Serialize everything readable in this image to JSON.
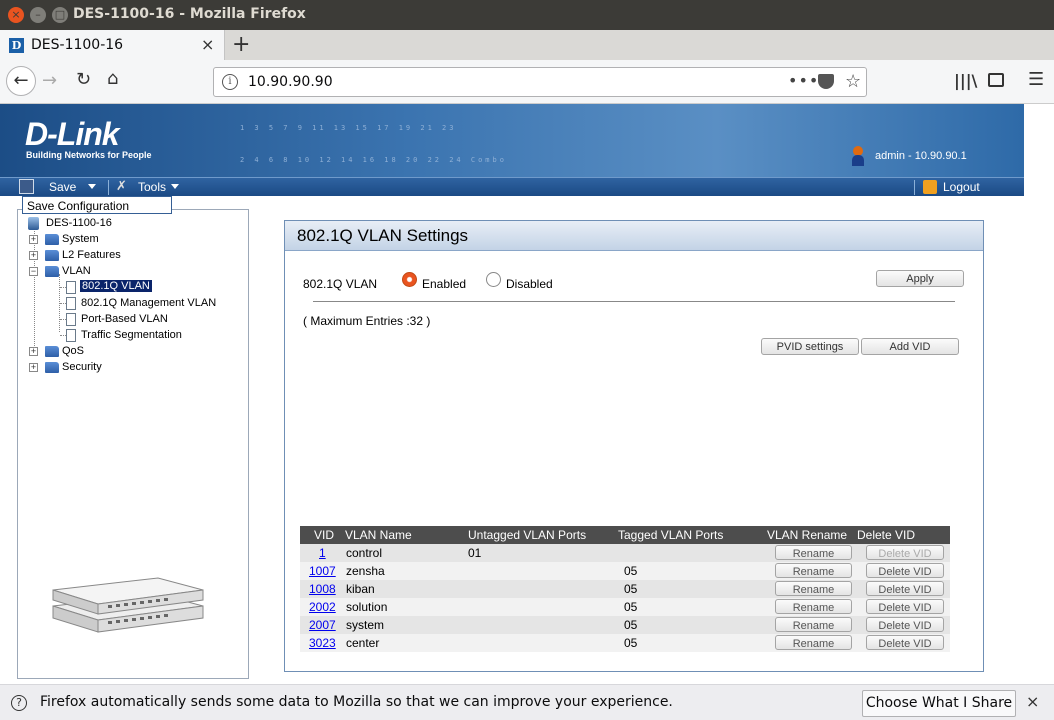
{
  "window": {
    "title": "DES-1100-16 - Mozilla Firefox",
    "close_glyph": "×",
    "min_glyph": "–",
    "max_glyph": "□"
  },
  "tab": {
    "favicon": "D",
    "title": "DES-1100-16",
    "close": "×",
    "new_tab": "+"
  },
  "nav": {
    "back": "←",
    "forward": "→",
    "reload": "↻",
    "home": "⌂",
    "url": "10.90.90.90",
    "info": "i",
    "dots": "•••",
    "star": "☆",
    "library": "|||\\",
    "menu": "☰"
  },
  "banner": {
    "logo": "D-Link",
    "tagline": "Building Networks for People",
    "ports_top": "1  3  5  7  9 11 13 15 17 19 21 23",
    "ports_bottom": "2  4  6  8 10 12 14 16 18 20 22 24  Combo",
    "user": "admin - 10.90.90.1"
  },
  "menubar": {
    "save": "Save",
    "tools": "Tools",
    "tools_icon": "✗",
    "logout": "Logout"
  },
  "dropdown": {
    "item": "Save Configuration"
  },
  "tree": {
    "root": "DES-1100-16",
    "items": [
      {
        "label": "System"
      },
      {
        "label": "L2 Features"
      },
      {
        "label": "VLAN"
      },
      {
        "label": "802.1Q VLAN"
      },
      {
        "label": "802.1Q Management VLAN"
      },
      {
        "label": "Port-Based VLAN"
      },
      {
        "label": "Traffic Segmentation"
      },
      {
        "label": "QoS"
      },
      {
        "label": "Security"
      }
    ],
    "plus": "+",
    "minus": "−"
  },
  "main": {
    "title": "802.1Q VLAN Settings",
    "vlan_label": "802.1Q VLAN",
    "enabled": "Enabled",
    "disabled": "Disabled",
    "apply": "Apply",
    "max_entries": "( Maximum Entries :32 )",
    "pvid_settings": "PVID settings",
    "add_vid": "Add VID"
  },
  "table": {
    "headers": [
      "VID",
      "VLAN Name",
      "Untagged VLAN Ports",
      "Tagged VLAN Ports",
      "VLAN Rename",
      "Delete VID"
    ],
    "rename": "Rename",
    "delete": "Delete VID",
    "rows": [
      {
        "vid": "1",
        "name": "control",
        "untagged": "01",
        "tagged": ""
      },
      {
        "vid": "1007",
        "name": "zensha",
        "untagged": "",
        "tagged": "05"
      },
      {
        "vid": "1008",
        "name": "kiban",
        "untagged": "",
        "tagged": "05"
      },
      {
        "vid": "2002",
        "name": "solution",
        "untagged": "",
        "tagged": "05"
      },
      {
        "vid": "2007",
        "name": "system",
        "untagged": "",
        "tagged": "05"
      },
      {
        "vid": "3023",
        "name": "center",
        "untagged": "",
        "tagged": "05"
      }
    ]
  },
  "notification": {
    "icon": "?",
    "text": "Firefox automatically sends some data to Mozilla so that we can improve your experience.",
    "button": "Choose What I Share",
    "close": "×"
  }
}
